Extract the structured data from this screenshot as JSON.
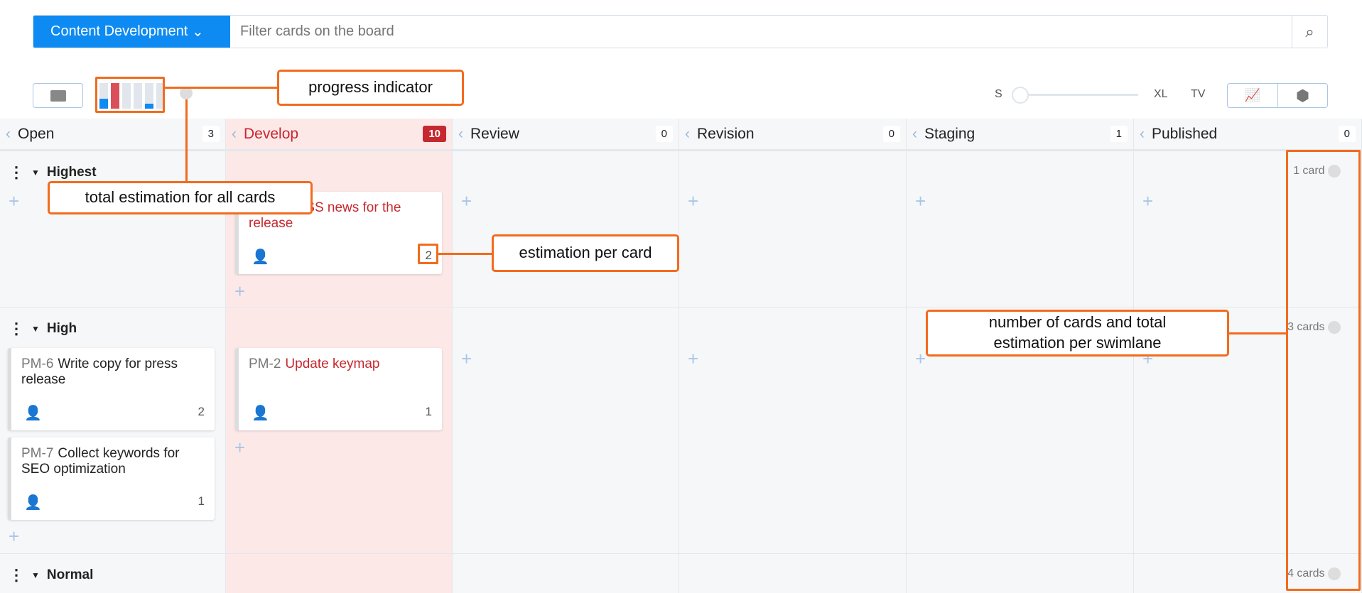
{
  "topbar": {
    "board": "Content Development",
    "board_caret": "⌄",
    "filter_placeholder": "Filter cards on the board",
    "search_icon": "⌕"
  },
  "toolbar": {
    "size_labels": [
      "S",
      "XL",
      "TV"
    ],
    "size_value": 0
  },
  "progress": {
    "bars": [
      {
        "fill": 0.4,
        "color": "#0d8bf2"
      },
      {
        "fill": 1,
        "color": "#d9505a"
      },
      {
        "fill": 0,
        "color": "#0d8bf2"
      },
      {
        "fill": 0,
        "color": "#0d8bf2"
      },
      {
        "fill": 0.2,
        "color": "#0d8bf2"
      },
      {
        "fill": 0,
        "color": "#0d8bf2"
      }
    ]
  },
  "columns": [
    {
      "name": "Open",
      "count": "3"
    },
    {
      "name": "Develop",
      "count": "10"
    },
    {
      "name": "Review",
      "count": "0"
    },
    {
      "name": "Revision",
      "count": "0"
    },
    {
      "name": "Staging",
      "count": "1"
    },
    {
      "name": "Published",
      "count": "0"
    }
  ],
  "lanes": [
    {
      "name": "Highest",
      "count": "1 card"
    },
    {
      "name": "High",
      "count": "3 cards"
    },
    {
      "name": "Normal",
      "count": "4 cards"
    }
  ],
  "cards": [
    {
      "id": "",
      "title": "Update RSS news for the release",
      "estimate": "2"
    },
    {
      "id": "PM-6",
      "title": "Write copy for press release",
      "estimate": "2"
    },
    {
      "id": "PM-7",
      "title": "Collect keywords for SEO optimization",
      "estimate": "1"
    },
    {
      "id": "PM-2",
      "title": "Update keymap",
      "estimate": "1"
    }
  ],
  "annotations": {
    "progress": "progress indicator",
    "total": "total estimation for all cards",
    "per_card": "estimation per card",
    "per_lane": "number of cards and total estimation per swimlane"
  }
}
